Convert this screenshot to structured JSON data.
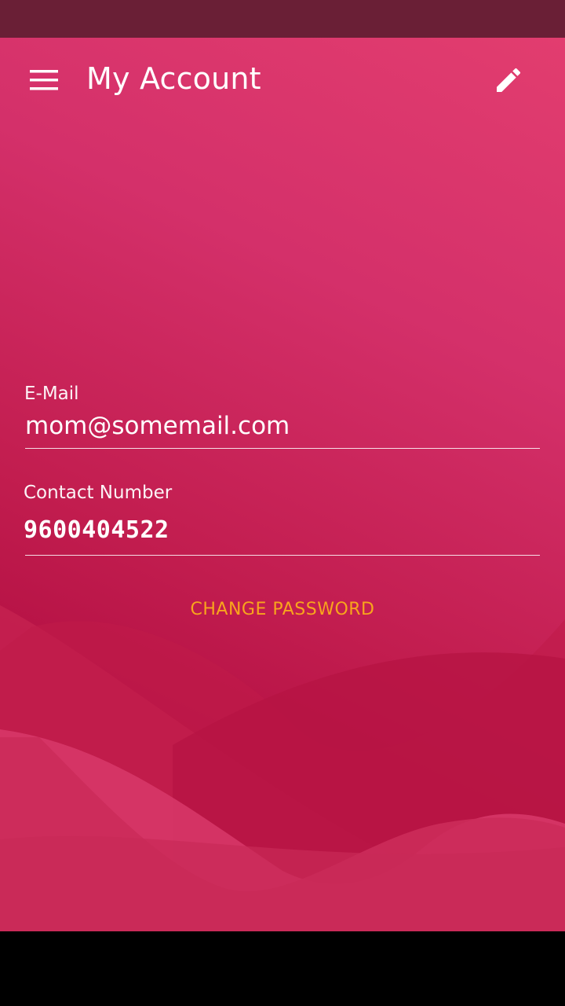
{
  "app_bar": {
    "title": "My Account",
    "menu_icon": "hamburger-menu-icon",
    "edit_icon": "pencil-edit-icon"
  },
  "form": {
    "email": {
      "label": "E-Mail",
      "value": "mom@somemail.com"
    },
    "contact": {
      "label": "Contact Number",
      "value": "9600404522"
    }
  },
  "actions": {
    "change_password": "CHANGE PASSWORD"
  },
  "colors": {
    "status_bar": "#6a1f36",
    "background_primary": "#d4306a",
    "background_dark": "#b61245",
    "accent_action": "#f8a51c",
    "text": "#ffffff",
    "navigation_bar": "#000000"
  }
}
